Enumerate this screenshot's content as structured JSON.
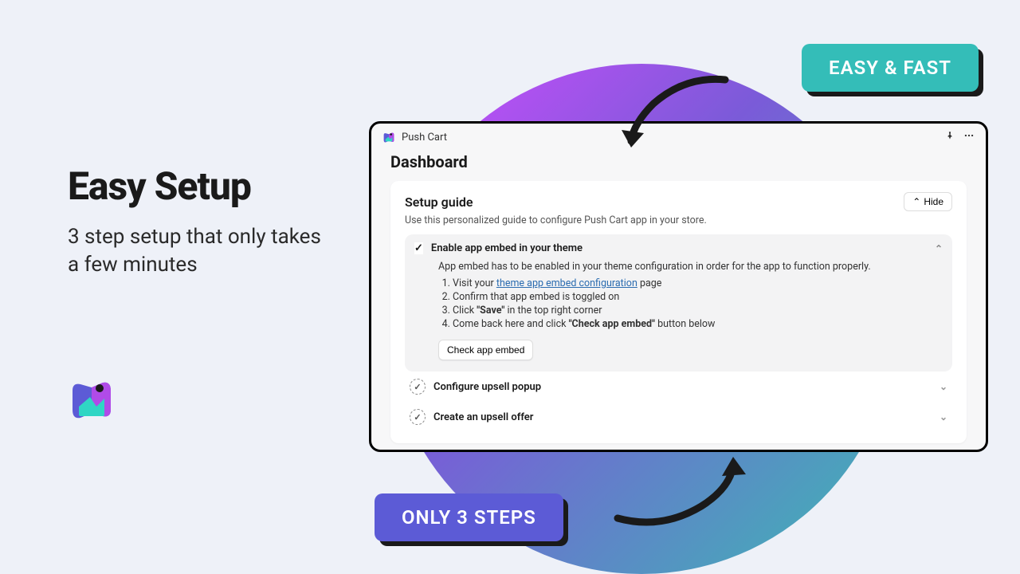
{
  "hero": {
    "title": "Easy Setup",
    "subtitle": "3 step setup that only takes a few minutes"
  },
  "callouts": {
    "top": "EASY & FAST",
    "bottom": "ONLY 3 STEPS"
  },
  "app": {
    "name": "Push Cart"
  },
  "dashboard": {
    "heading": "Dashboard",
    "panel_title": "Setup guide",
    "hide_label": "Hide",
    "description": "Use this personalized guide to configure Push Cart app in your store.",
    "steps": [
      {
        "title": "Enable app embed in your theme",
        "intro": "App embed has to be enabled in your theme configuration in order for the app to function properly.",
        "li1_prefix": "Visit your ",
        "li1_link": "theme app embed configuration",
        "li1_suffix": " page",
        "li2": "Confirm that app embed is toggled on",
        "li3_a": "Click ",
        "li3_b": "\"Save\"",
        "li3_c": " in the top right corner",
        "li4_a": "Come back here and click ",
        "li4_b": "\"Check app embed\"",
        "li4_c": " button below",
        "button": "Check app embed"
      },
      {
        "title": "Configure upsell popup"
      },
      {
        "title": "Create an upsell offer"
      }
    ]
  }
}
